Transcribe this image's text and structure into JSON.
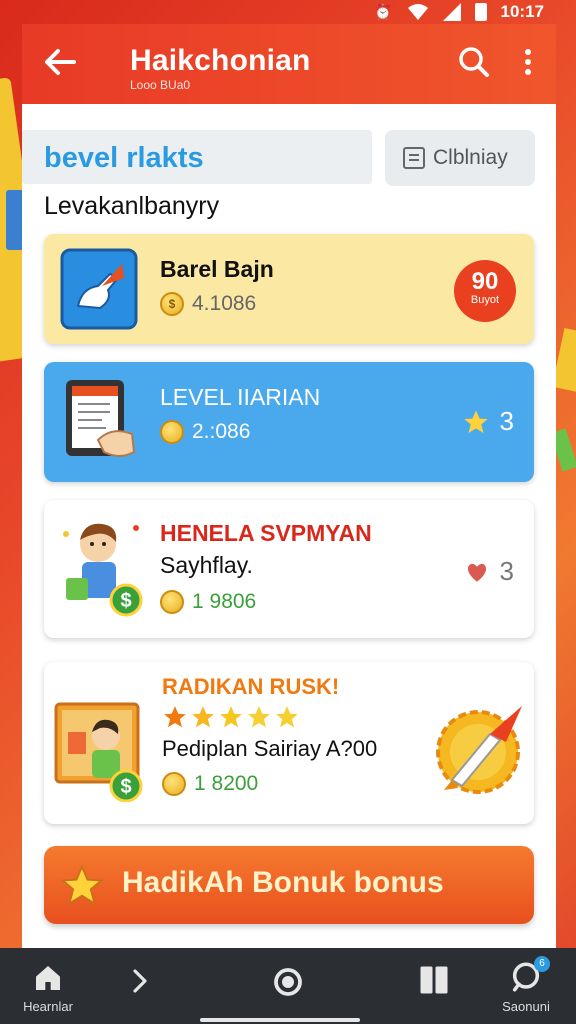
{
  "status_bar": {
    "time": "10:17"
  },
  "app_bar": {
    "title": "Haikchonian",
    "subtitle": "Looo BUa0"
  },
  "tabs": {
    "active_label": "bevel rlakts",
    "other_label": "Clblniay"
  },
  "section_label": "Levakanlbanyry",
  "cards": [
    {
      "title": "Barel Bajn",
      "value": "4.1086",
      "badge_number": "90",
      "badge_label": "Buyot",
      "bg": "#fbe8a3"
    },
    {
      "title": "LEVEL IIARIAN",
      "value": "2.:086",
      "rank": "3",
      "bg": "#4aa8ec"
    },
    {
      "title": "HENELA SVPMYAN",
      "subtitle": "Sayhflay.",
      "value": "1 9806",
      "rank": "3",
      "title_color": "#d8281c",
      "value_color": "#3aa03a"
    },
    {
      "title": "RADIKAN RUSK!",
      "subtitle": "Pediplan  Sairiay A?00",
      "value": "1 8200",
      "stars": 5,
      "title_color": "#f07a10",
      "value_color": "#3aa03a"
    }
  ],
  "cta": {
    "label": "HadikAh Bonuk bonus"
  },
  "bottom_nav": {
    "home_label": "Hearnlar",
    "search_label": "Saonuni",
    "search_badge": "6"
  }
}
